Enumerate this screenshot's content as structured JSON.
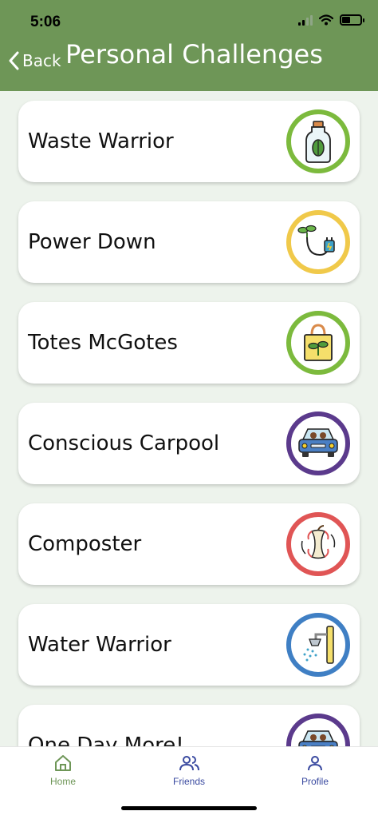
{
  "status_bar": {
    "time": "5:06"
  },
  "header": {
    "back_label": "Back",
    "title": "Personal Challenges"
  },
  "challenges": [
    {
      "title": "Waste Warrior",
      "icon": "bottle-leaf-icon",
      "ring_color": "#7cba3d"
    },
    {
      "title": "Power Down",
      "icon": "plug-sprout-icon",
      "ring_color": "#f0c94a"
    },
    {
      "title": "Totes McGotes",
      "icon": "tote-bag-icon",
      "ring_color": "#7cba3d"
    },
    {
      "title": "Conscious Carpool",
      "icon": "carpool-icon",
      "ring_color": "#5b3a8c"
    },
    {
      "title": "Composter",
      "icon": "apple-core-icon",
      "ring_color": "#e05555"
    },
    {
      "title": "Water Warrior",
      "icon": "shower-icon",
      "ring_color": "#3f7fc4"
    },
    {
      "title": "One Day More!",
      "icon": "carpool-icon",
      "ring_color": "#5b3a8c"
    }
  ],
  "tabs": [
    {
      "label": "Home",
      "icon": "home-icon",
      "color": "#6e9657"
    },
    {
      "label": "Friends",
      "icon": "friends-icon",
      "color": "#3a4aa0"
    },
    {
      "label": "Profile",
      "icon": "profile-icon",
      "color": "#3a4aa0"
    }
  ]
}
